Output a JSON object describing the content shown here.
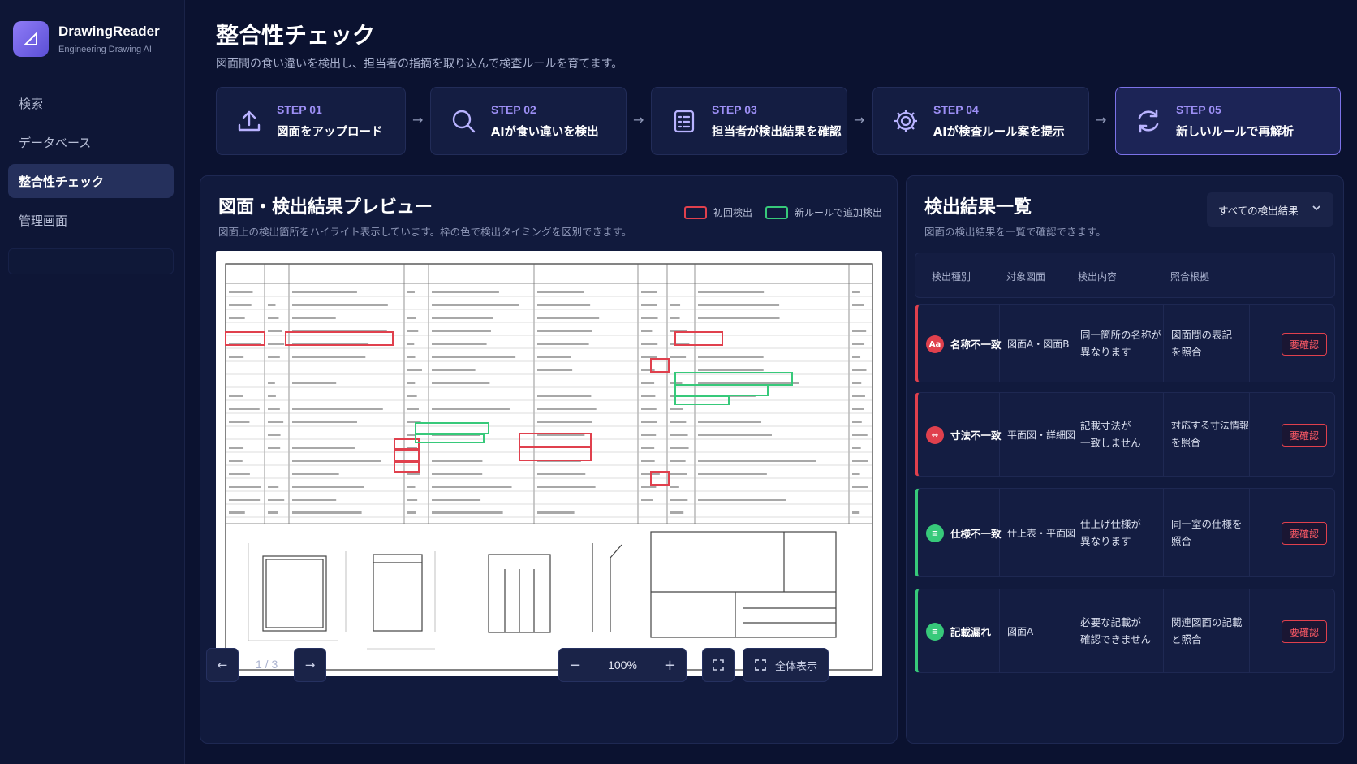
{
  "app": {
    "name": "DrawingReader",
    "subtitle": "Engineering Drawing AI"
  },
  "nav": {
    "items": [
      {
        "label": "検索"
      },
      {
        "label": "データベース"
      },
      {
        "label": "整合性チェック",
        "active": true
      },
      {
        "label": "管理画面"
      }
    ]
  },
  "header": {
    "title": "整合性チェック",
    "description": "図面間の食い違いを検出し、担当者の指摘を取り込んで検査ルールを育てます。"
  },
  "steps": [
    {
      "num": "STEP 01",
      "label": "図面をアップロード",
      "icon": "upload-icon"
    },
    {
      "num": "STEP 02",
      "label": "AIが食い違いを検出",
      "icon": "search-icon"
    },
    {
      "num": "STEP 03",
      "label": "担当者が検出結果を確認",
      "icon": "checklist-icon"
    },
    {
      "num": "STEP 04",
      "label": "AIが検査ルール案を提示",
      "icon": "gear-icon"
    },
    {
      "num": "STEP 05",
      "label": "新しいルールで再解析",
      "icon": "refresh-icon",
      "active": true
    }
  ],
  "preview": {
    "title": "図面・検出結果プレビュー",
    "description": "図面上の検出箇所をハイライト表示しています。枠の色で検出タイミングを区別できます。",
    "legend": {
      "initial": "初回検出",
      "new_rule": "新ルールで追加検出"
    },
    "page_indicator": "1 / 3",
    "zoom": "100%",
    "fit_label": "全体表示"
  },
  "results": {
    "title": "検出結果一覧",
    "description": "図面の検出結果を一覧で確認できます。",
    "filter": "すべての検出結果",
    "columns": [
      "検出種別",
      "対象図面",
      "検出内容",
      "照合根拠"
    ],
    "rows": [
      {
        "icon": "Aa",
        "type": "名称不一致",
        "drawing": "図面A・図面B",
        "content": [
          "同一箇所の名称が",
          "異なります"
        ],
        "basis": [
          "図面間の表記",
          "を照合"
        ],
        "badge": "要確認",
        "color": "red"
      },
      {
        "icon": "↔",
        "type": "寸法不一致",
        "drawing": "平面図・詳細図",
        "content": [
          "記載寸法が",
          "一致しません"
        ],
        "basis": [
          "対応する寸法情報",
          "を照合"
        ],
        "badge": "要確認",
        "color": "red"
      },
      {
        "icon": "≡",
        "type": "仕様不一致",
        "drawing": "仕上表・平面図",
        "content": [
          "仕上げ仕様が",
          "異なります"
        ],
        "basis": [
          "同一室の仕様を",
          "照合"
        ],
        "badge": "要確認",
        "color": "green"
      },
      {
        "icon": "≡",
        "type": "記載漏れ",
        "drawing": "図面A",
        "content": [
          "必要な記載が",
          "確認できません"
        ],
        "basis": [
          "関連図面の記載",
          "と照合"
        ],
        "badge": "要確認",
        "color": "green"
      }
    ]
  },
  "colors": {
    "accent": "#7c72e8",
    "initial": "#e0404d",
    "new_rule": "#37c97a",
    "bg": "#0b1230"
  }
}
